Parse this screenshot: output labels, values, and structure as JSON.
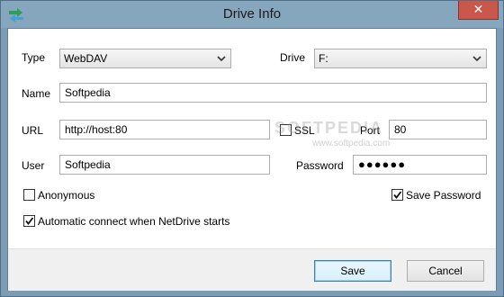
{
  "window": {
    "title": "Drive Info",
    "close_symbol": "✕"
  },
  "form": {
    "type_label": "Type",
    "type_value": "WebDAV",
    "drive_label": "Drive",
    "drive_value": "F:",
    "name_label": "Name",
    "name_value": "Softpedia",
    "url_label": "URL",
    "url_value": "http://host:80",
    "ssl_label": "SSL",
    "ssl_checked": false,
    "port_label": "Port",
    "port_value": "80",
    "user_label": "User",
    "user_value": "Softpedia",
    "password_label": "Password",
    "password_value": "●●●●●●",
    "anonymous_label": "Anonymous",
    "anonymous_checked": false,
    "save_password_label": "Save Password",
    "save_password_checked": true,
    "auto_connect_label": "Automatic connect when NetDrive starts",
    "auto_connect_checked": true
  },
  "buttons": {
    "save": "Save",
    "cancel": "Cancel"
  },
  "watermark": {
    "text": "SOFTPEDIA",
    "url": "www.softpedia.com"
  },
  "colors": {
    "frame": "#7d9cb3",
    "close": "#c9574c",
    "accent": "#3c7fb1"
  }
}
